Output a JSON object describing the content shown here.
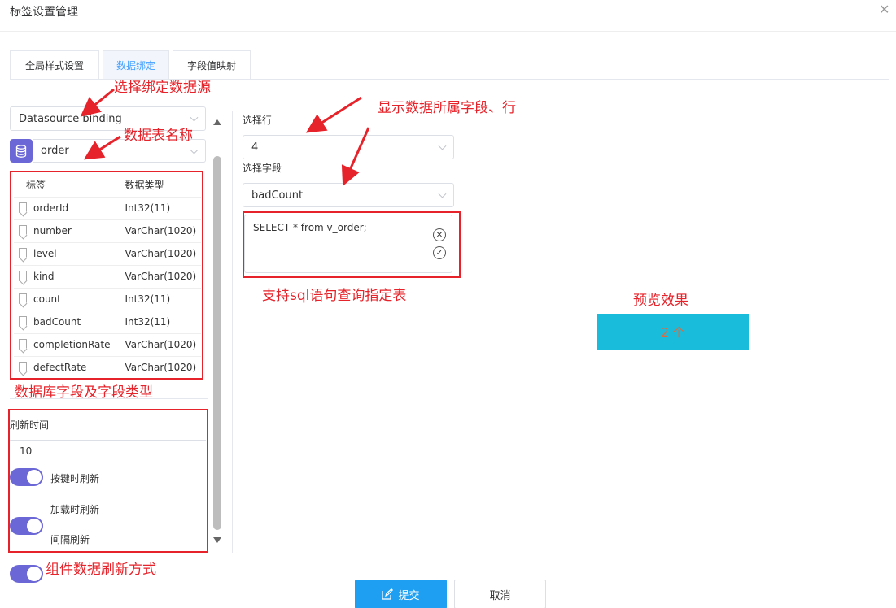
{
  "dialog": {
    "title": "标签设置管理",
    "close_icon": "close-icon"
  },
  "tabs": [
    {
      "label": "全局样式设置",
      "active": false
    },
    {
      "label": "数据绑定",
      "active": true
    },
    {
      "label": "字段值映射",
      "active": false
    }
  ],
  "left": {
    "datasource_select": "Datasource binding",
    "table_select": "order",
    "fields_table": {
      "headers": [
        "标签",
        "数据类型"
      ],
      "rows": [
        {
          "name": "orderId",
          "type": "Int32(11)"
        },
        {
          "name": "number",
          "type": "VarChar(1020)"
        },
        {
          "name": "level",
          "type": "VarChar(1020)"
        },
        {
          "name": "kind",
          "type": "VarChar(1020)"
        },
        {
          "name": "count",
          "type": "Int32(11)"
        },
        {
          "name": "badCount",
          "type": "Int32(11)"
        },
        {
          "name": "completionRate",
          "type": "VarChar(1020)"
        },
        {
          "name": "defectRate",
          "type": "VarChar(1020)"
        }
      ]
    },
    "refresh": {
      "label": "刷新时间",
      "value": "10",
      "toggles": [
        {
          "label": "按键时刷新",
          "on": true
        },
        {
          "label": "加载时刷新",
          "on": true
        },
        {
          "label": "间隔刷新",
          "on": true
        }
      ]
    }
  },
  "middle": {
    "row_label": "选择行",
    "row_value": "4",
    "field_label": "选择字段",
    "field_value": "badCount",
    "sql": "SELECT * from v_order;",
    "clear_icon": "✕",
    "confirm_icon": "✓"
  },
  "preview": {
    "label": "预览效果",
    "value": "2 个",
    "box_color": "#1abcdc",
    "text_color": "#e06a3c"
  },
  "annotations": {
    "datasource": "选择绑定数据源",
    "table_name": "数据表名称",
    "fields": "数据库字段及字段类型",
    "refresh": "组件数据刷新方式",
    "row_field": "显示数据所属字段、行",
    "sql": "支持sql语句查询指定表",
    "color": "#e6232a"
  },
  "footer": {
    "submit": "提交",
    "cancel": "取消"
  }
}
